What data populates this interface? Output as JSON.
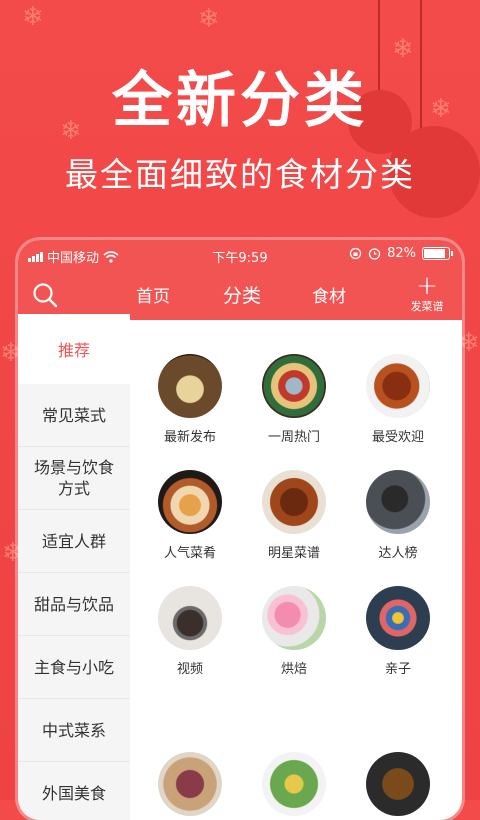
{
  "promo": {
    "title": "全新分类",
    "subtitle": "最全面细致的食材分类"
  },
  "status_bar": {
    "carrier": "中国移动",
    "time": "下午9:59",
    "battery": "82%"
  },
  "navbar": {
    "tabs": [
      {
        "label": "首页"
      },
      {
        "label": "分类"
      },
      {
        "label": "食材"
      }
    ],
    "active_tab": "分类",
    "add_label": "发菜谱",
    "add_symbol": "+"
  },
  "sidebar": {
    "items": [
      {
        "label": "推荐"
      },
      {
        "label": "常见菜式"
      },
      {
        "label": "场景与饮食方式"
      },
      {
        "label": "适宜人群"
      },
      {
        "label": "甜品与饮品"
      },
      {
        "label": "主食与小吃"
      },
      {
        "label": "中式菜系"
      },
      {
        "label": "外国美食"
      }
    ],
    "active": "推荐"
  },
  "grid": {
    "items": [
      {
        "label": "最新发布",
        "icon": "food-photo"
      },
      {
        "label": "一周热门",
        "icon": "platter-photo"
      },
      {
        "label": "最受欢迎",
        "icon": "braised-meat-photo"
      },
      {
        "label": "人气菜肴",
        "icon": "soup-photo"
      },
      {
        "label": "明星菜谱",
        "icon": "ribs-photo"
      },
      {
        "label": "达人榜",
        "icon": "person-photo"
      },
      {
        "label": "视频",
        "icon": "video-photo"
      },
      {
        "label": "烘焙",
        "icon": "macaron-photo"
      },
      {
        "label": "亲子",
        "icon": "kids-food-photo"
      }
    ]
  },
  "colors": {
    "brand_red": "#f25454",
    "background_red": "#f04545",
    "active_text": "#f25454"
  }
}
